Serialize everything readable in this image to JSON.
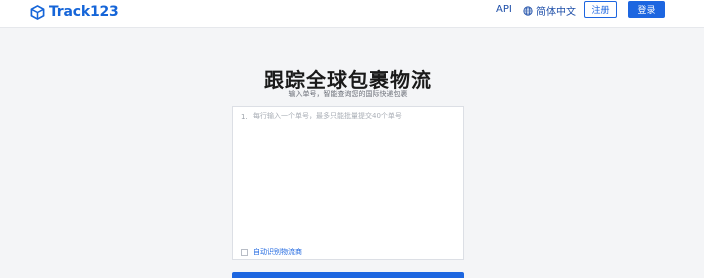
{
  "header": {
    "brand": "Track123",
    "nav_api": "API",
    "language": "简体中文",
    "register_label": "注册",
    "login_label": "登录"
  },
  "hero": {
    "title": "跟踪全球包裹物流",
    "subtitle": "输入单号，智能查询您的国际快递包裹"
  },
  "tracking": {
    "line_number": "1.",
    "placeholder": "每行输入一个单号，最多只能批量提交40个单号",
    "value": "",
    "auto_detect_label": "自动识别物流商",
    "auto_detect_checked": false
  },
  "colors": {
    "brand": "#1565d8",
    "primary_button": "#1d66e0",
    "nav_text": "#1d4ea8"
  },
  "icons": {
    "logo": "box-logo-icon",
    "language": "globe-icon",
    "checkbox": "checkbox-icon"
  }
}
